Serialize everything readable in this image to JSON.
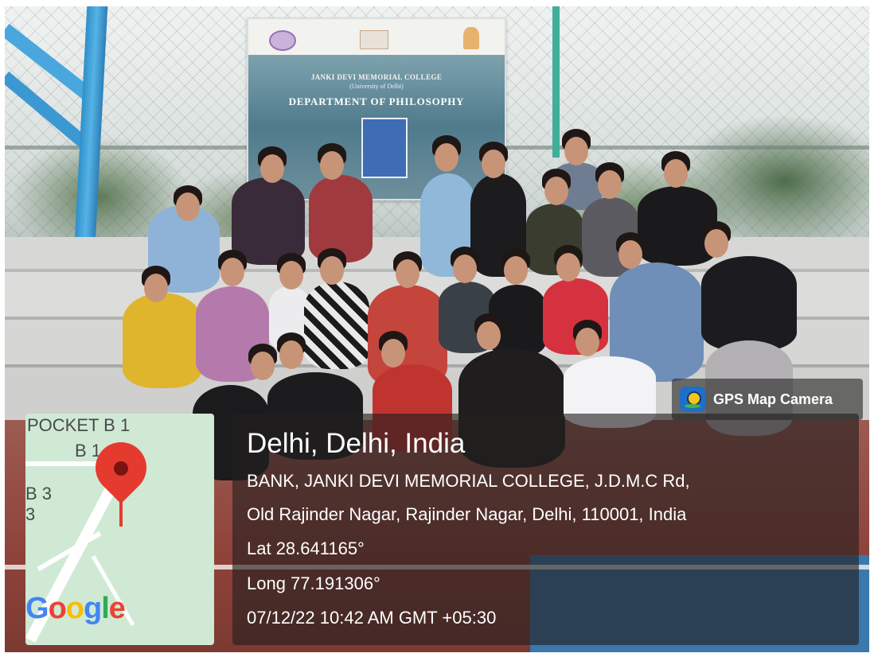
{
  "banner": {
    "line1": "JANKI DEVI MEMORIAL COLLEGE",
    "line2": "(University of Delhi)",
    "line3": "DEPARTMENT OF PHILOSOPHY"
  },
  "gps_badge": {
    "icon": "gps-map-camera-icon",
    "label": "GPS Map Camera"
  },
  "map": {
    "labels": [
      "POCKET B 1",
      "B 1",
      "B 3",
      "3"
    ],
    "logo": "Google",
    "pin_icon": "map-pin-icon",
    "colors": {
      "land": "#cfe9d5",
      "pin": "#e53b2f"
    }
  },
  "location": {
    "city": "Delhi, Delhi, India",
    "address_line1": "BANK, JANKI DEVI MEMORIAL COLLEGE, J.D.M.C Rd,",
    "address_line2": "Old Rajinder Nagar, Rajinder Nagar, Delhi, 110001, India",
    "latitude": "Lat 28.641165°",
    "longitude": "Long 77.191306°",
    "timestamp": "07/12/22 10:42 AM GMT +05:30"
  }
}
